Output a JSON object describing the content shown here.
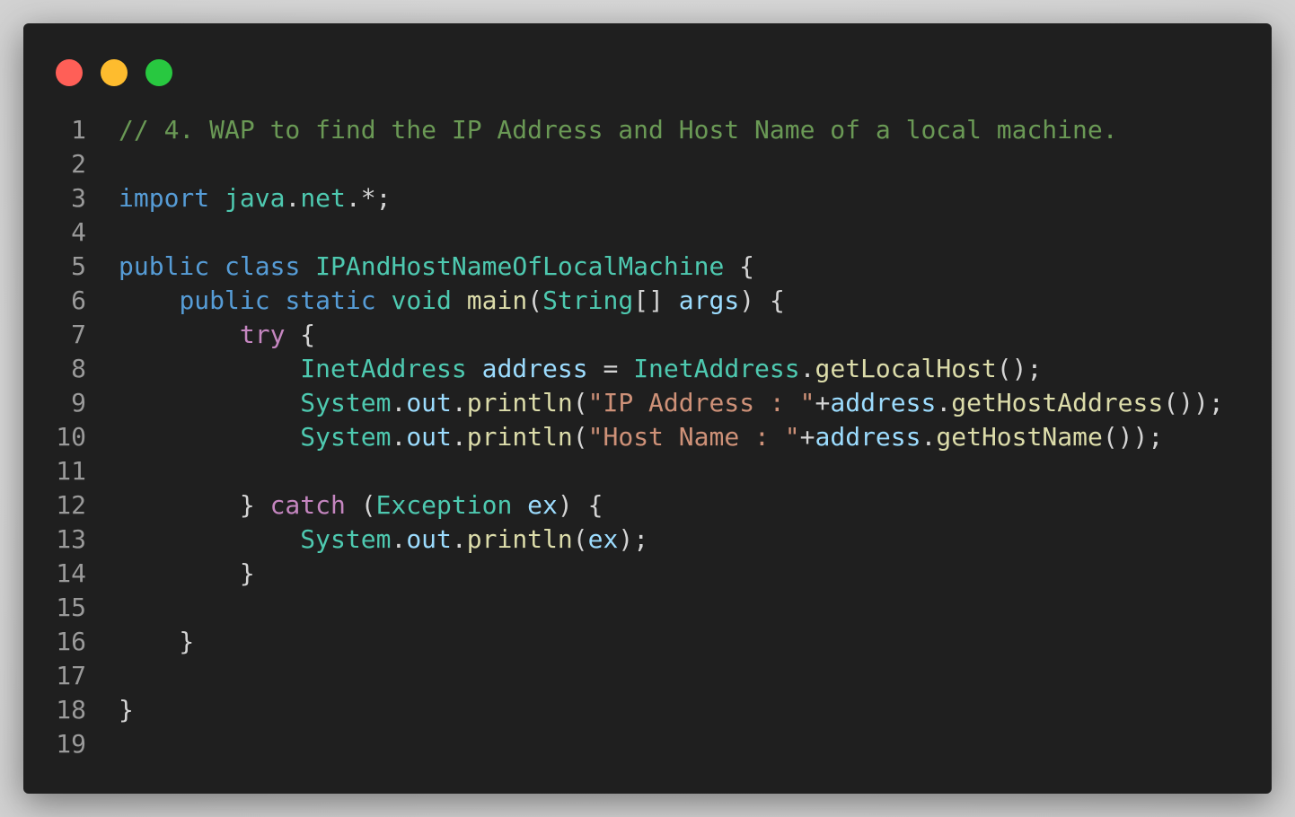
{
  "window": {
    "controls": [
      {
        "name": "close-button",
        "color": "#ff5f57"
      },
      {
        "name": "minimize-button",
        "color": "#febc2e"
      },
      {
        "name": "maximize-button",
        "color": "#28c840"
      }
    ]
  },
  "code": {
    "lines": [
      {
        "num": "1",
        "tokens": [
          {
            "t": "// 4. WAP to find the IP Address and Host Name of a local machine.",
            "c": "comment"
          }
        ]
      },
      {
        "num": "2",
        "tokens": []
      },
      {
        "num": "3",
        "tokens": [
          {
            "t": "import",
            "c": "kw"
          },
          {
            "t": " ",
            "c": "plain"
          },
          {
            "t": "java",
            "c": "type"
          },
          {
            "t": ".",
            "c": "punc"
          },
          {
            "t": "net",
            "c": "type"
          },
          {
            "t": ".*;",
            "c": "punc"
          }
        ]
      },
      {
        "num": "4",
        "tokens": []
      },
      {
        "num": "5",
        "tokens": [
          {
            "t": "public",
            "c": "kw"
          },
          {
            "t": " ",
            "c": "plain"
          },
          {
            "t": "class",
            "c": "kw"
          },
          {
            "t": " ",
            "c": "plain"
          },
          {
            "t": "IPAndHostNameOfLocalMachine",
            "c": "type"
          },
          {
            "t": " {",
            "c": "punc"
          }
        ]
      },
      {
        "num": "6",
        "tokens": [
          {
            "t": "    ",
            "c": "plain"
          },
          {
            "t": "public",
            "c": "kw"
          },
          {
            "t": " ",
            "c": "plain"
          },
          {
            "t": "static",
            "c": "kw"
          },
          {
            "t": " ",
            "c": "plain"
          },
          {
            "t": "void",
            "c": "type"
          },
          {
            "t": " ",
            "c": "plain"
          },
          {
            "t": "main",
            "c": "func"
          },
          {
            "t": "(",
            "c": "punc"
          },
          {
            "t": "String",
            "c": "type"
          },
          {
            "t": "[] ",
            "c": "punc"
          },
          {
            "t": "args",
            "c": "var"
          },
          {
            "t": ") {",
            "c": "punc"
          }
        ]
      },
      {
        "num": "7",
        "tokens": [
          {
            "t": "        ",
            "c": "plain"
          },
          {
            "t": "try",
            "c": "ctrl"
          },
          {
            "t": " {",
            "c": "punc"
          }
        ]
      },
      {
        "num": "8",
        "tokens": [
          {
            "t": "            ",
            "c": "plain"
          },
          {
            "t": "InetAddress",
            "c": "type"
          },
          {
            "t": " ",
            "c": "plain"
          },
          {
            "t": "address",
            "c": "var"
          },
          {
            "t": " = ",
            "c": "punc"
          },
          {
            "t": "InetAddress",
            "c": "type"
          },
          {
            "t": ".",
            "c": "punc"
          },
          {
            "t": "getLocalHost",
            "c": "func"
          },
          {
            "t": "();",
            "c": "punc"
          }
        ]
      },
      {
        "num": "9",
        "tokens": [
          {
            "t": "            ",
            "c": "plain"
          },
          {
            "t": "System",
            "c": "type"
          },
          {
            "t": ".",
            "c": "punc"
          },
          {
            "t": "out",
            "c": "var"
          },
          {
            "t": ".",
            "c": "punc"
          },
          {
            "t": "println",
            "c": "func"
          },
          {
            "t": "(",
            "c": "punc"
          },
          {
            "t": "\"IP Address : \"",
            "c": "str"
          },
          {
            "t": "+",
            "c": "punc"
          },
          {
            "t": "address",
            "c": "var"
          },
          {
            "t": ".",
            "c": "punc"
          },
          {
            "t": "getHostAddress",
            "c": "func"
          },
          {
            "t": "());",
            "c": "punc"
          }
        ]
      },
      {
        "num": "10",
        "tokens": [
          {
            "t": "            ",
            "c": "plain"
          },
          {
            "t": "System",
            "c": "type"
          },
          {
            "t": ".",
            "c": "punc"
          },
          {
            "t": "out",
            "c": "var"
          },
          {
            "t": ".",
            "c": "punc"
          },
          {
            "t": "println",
            "c": "func"
          },
          {
            "t": "(",
            "c": "punc"
          },
          {
            "t": "\"Host Name : \"",
            "c": "str"
          },
          {
            "t": "+",
            "c": "punc"
          },
          {
            "t": "address",
            "c": "var"
          },
          {
            "t": ".",
            "c": "punc"
          },
          {
            "t": "getHostName",
            "c": "func"
          },
          {
            "t": "());",
            "c": "punc"
          }
        ]
      },
      {
        "num": "11",
        "tokens": []
      },
      {
        "num": "12",
        "tokens": [
          {
            "t": "        } ",
            "c": "punc"
          },
          {
            "t": "catch",
            "c": "ctrl"
          },
          {
            "t": " (",
            "c": "punc"
          },
          {
            "t": "Exception",
            "c": "type"
          },
          {
            "t": " ",
            "c": "plain"
          },
          {
            "t": "ex",
            "c": "var"
          },
          {
            "t": ") {",
            "c": "punc"
          }
        ]
      },
      {
        "num": "13",
        "tokens": [
          {
            "t": "            ",
            "c": "plain"
          },
          {
            "t": "System",
            "c": "type"
          },
          {
            "t": ".",
            "c": "punc"
          },
          {
            "t": "out",
            "c": "var"
          },
          {
            "t": ".",
            "c": "punc"
          },
          {
            "t": "println",
            "c": "func"
          },
          {
            "t": "(",
            "c": "punc"
          },
          {
            "t": "ex",
            "c": "var"
          },
          {
            "t": ");",
            "c": "punc"
          }
        ]
      },
      {
        "num": "14",
        "tokens": [
          {
            "t": "        }",
            "c": "punc"
          }
        ]
      },
      {
        "num": "15",
        "tokens": []
      },
      {
        "num": "16",
        "tokens": [
          {
            "t": "    }",
            "c": "punc"
          }
        ]
      },
      {
        "num": "17",
        "tokens": []
      },
      {
        "num": "18",
        "tokens": [
          {
            "t": "}",
            "c": "punc"
          }
        ]
      },
      {
        "num": "19",
        "tokens": []
      }
    ]
  }
}
